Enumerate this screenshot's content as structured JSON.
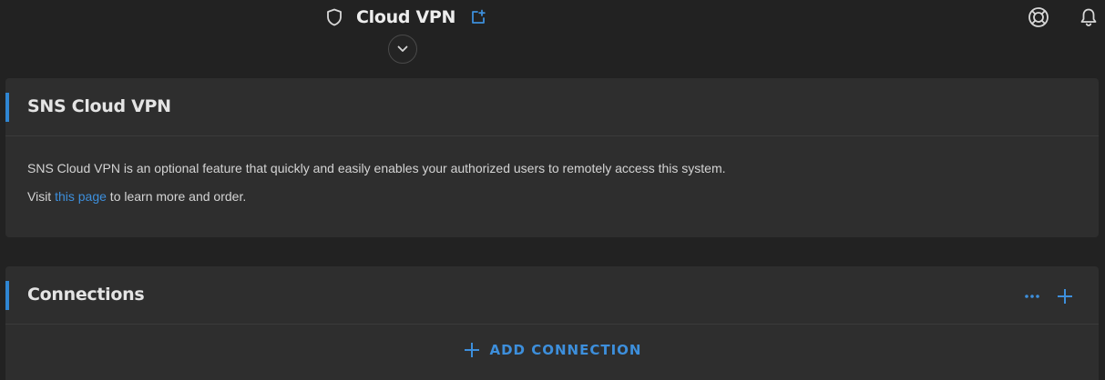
{
  "header": {
    "title": "Cloud VPN"
  },
  "intro_card": {
    "title": "SNS Cloud VPN",
    "description": "SNS Cloud VPN is an optional feature that quickly and easily enables your authorized users to remotely access this system.",
    "visit_prefix": "Visit ",
    "visit_link": "this page",
    "visit_suffix": " to learn more and order."
  },
  "connections_card": {
    "title": "Connections",
    "add_connection_label": "ADD CONNECTION"
  },
  "icons": {
    "title": "shield-icon",
    "open_external": "open-in-new-icon",
    "expand": "chevron-down-icon",
    "help": "lifebuoy-icon",
    "notifications": "bell-icon",
    "more": "more-horizontal-icon",
    "add": "plus-icon"
  },
  "colors": {
    "background": "#222222",
    "card": "#2e2e2e",
    "accent": "#2f86d3",
    "link": "#3d8fdc"
  }
}
